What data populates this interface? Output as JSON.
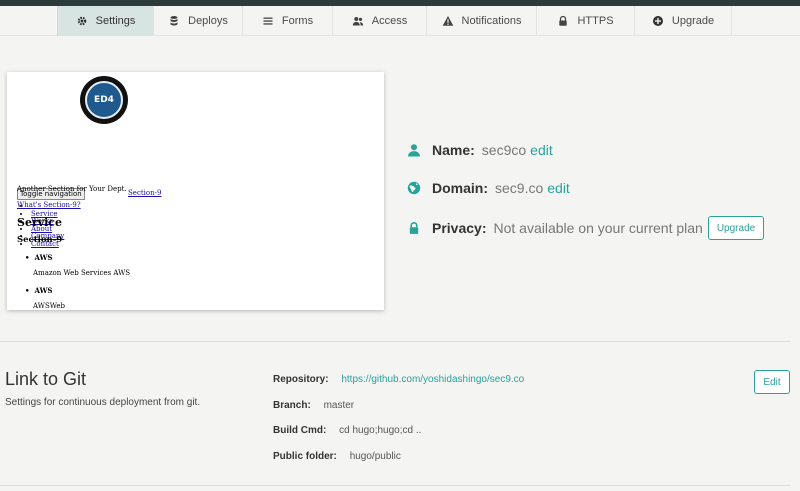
{
  "tabs": [
    {
      "label": "Settings",
      "icon": "gear-icon",
      "active": true
    },
    {
      "label": "Deploys",
      "icon": "database-icon"
    },
    {
      "label": "Forms",
      "icon": "list-icon"
    },
    {
      "label": "Access",
      "icon": "users-icon"
    },
    {
      "label": "Notifications",
      "icon": "warning-icon"
    },
    {
      "label": "HTTPS",
      "icon": "lock-icon"
    },
    {
      "label": "Upgrade",
      "icon": "plus-circle-icon"
    }
  ],
  "preview": {
    "logo_text": "ED4",
    "toggle": "Toggle navigation",
    "brand": "Section-9",
    "nav": [
      "Service",
      "Works",
      "About",
      "Company",
      "Contact"
    ],
    "tagline": "Another Section for Your Dept.",
    "whats_link": "What's Section-9?",
    "heading": "Service",
    "subheading": "Section-9",
    "item1_title": "AWS",
    "item1_text": "Amazon Web Services AWS",
    "item2_title": "AWS",
    "item2_text": "AWSWeb"
  },
  "site": {
    "name_label": "Name:",
    "name_value": "sec9co",
    "domain_label": "Domain:",
    "domain_value": "sec9.co",
    "privacy_label": "Privacy:",
    "privacy_value": "Not available on your current plan",
    "edit_label": "edit",
    "upgrade_label": "Upgrade"
  },
  "git": {
    "title": "Link to Git",
    "description": "Settings for continuous deployment from git.",
    "repo_label": "Repository:",
    "repo_value": "https://github.com/yoshidashingo/sec9.co",
    "branch_label": "Branch:",
    "branch_value": "master",
    "cmd_label": "Build Cmd:",
    "cmd_value": "cd hugo;hugo;cd ..",
    "folder_label": "Public folder:",
    "folder_value": "hugo/public",
    "edit_label": "Edit"
  },
  "colors": {
    "accent": "#27a39a",
    "active_tab": "#d8e4e1",
    "topbar": "#2e3b3b"
  }
}
